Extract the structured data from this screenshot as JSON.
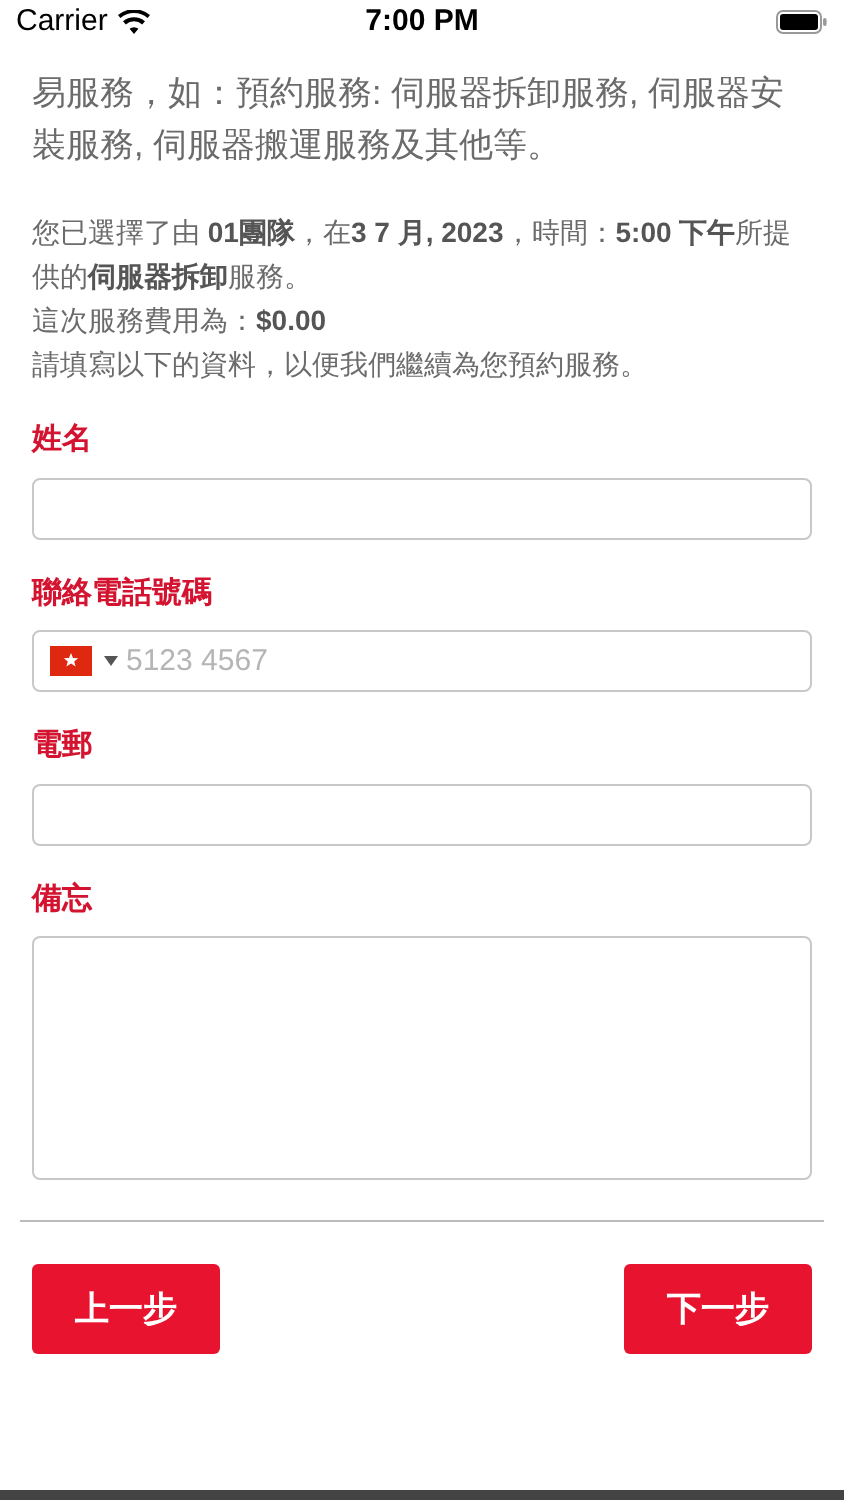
{
  "status_bar": {
    "carrier": "Carrier",
    "time": "7:00 PM"
  },
  "intro": "易服務，如：預約服務: 伺服器拆卸服務, 伺服器安裝服務, 伺服器搬運服務及其他等。",
  "summary": [
    "您已選擇了由 **01團隊**，在**3 7 月, 2023**，時間：**5:00 下午**所提供的**伺服器拆卸**服務。",
    "這次服務費用為：**$0.00**",
    "請填寫以下的資料，以便我們繼續為您預約服務。"
  ],
  "fields": [
    {
      "kind": "text",
      "label": "姓名"
    },
    {
      "kind": "phone",
      "label": "聯絡電話號碼",
      "placeholder": "5123 4567"
    },
    {
      "kind": "text",
      "label": "電郵"
    },
    {
      "kind": "textarea",
      "label": "備忘"
    }
  ],
  "buttons": {
    "back": "上一步",
    "next": "下一步"
  }
}
